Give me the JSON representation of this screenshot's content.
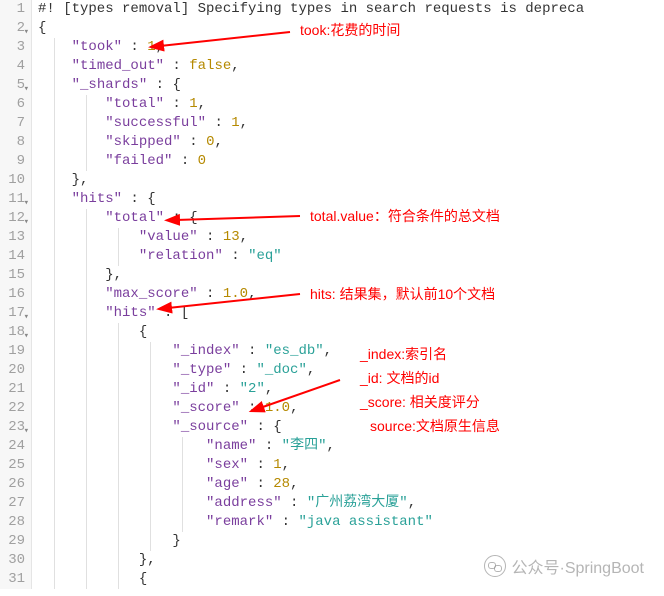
{
  "gutter_start": 1,
  "gutter_end": 31,
  "fold_lines": [
    2,
    5,
    11,
    12,
    17,
    18,
    23
  ],
  "lines": [
    {
      "indent": 0,
      "guides": [],
      "tokens": [
        {
          "cls": "punc",
          "t": "#! [types removal] Specifying types in search requests is depreca"
        }
      ]
    },
    {
      "indent": 0,
      "guides": [],
      "tokens": [
        {
          "cls": "punc",
          "t": "{"
        }
      ]
    },
    {
      "indent": 1,
      "guides": [
        1
      ],
      "tokens": [
        {
          "cls": "key",
          "t": "\"took\""
        },
        {
          "cls": "punc",
          "t": " : "
        },
        {
          "cls": "num",
          "t": "1"
        },
        {
          "cls": "punc",
          "t": ","
        }
      ]
    },
    {
      "indent": 1,
      "guides": [
        1
      ],
      "tokens": [
        {
          "cls": "key",
          "t": "\"timed_out\""
        },
        {
          "cls": "punc",
          "t": " : "
        },
        {
          "cls": "bool",
          "t": "false"
        },
        {
          "cls": "punc",
          "t": ","
        }
      ]
    },
    {
      "indent": 1,
      "guides": [
        1
      ],
      "tokens": [
        {
          "cls": "key",
          "t": "\"_shards\""
        },
        {
          "cls": "punc",
          "t": " : {"
        }
      ]
    },
    {
      "indent": 2,
      "guides": [
        1,
        2
      ],
      "tokens": [
        {
          "cls": "key",
          "t": "\"total\""
        },
        {
          "cls": "punc",
          "t": " : "
        },
        {
          "cls": "num",
          "t": "1"
        },
        {
          "cls": "punc",
          "t": ","
        }
      ]
    },
    {
      "indent": 2,
      "guides": [
        1,
        2
      ],
      "tokens": [
        {
          "cls": "key",
          "t": "\"successful\""
        },
        {
          "cls": "punc",
          "t": " : "
        },
        {
          "cls": "num",
          "t": "1"
        },
        {
          "cls": "punc",
          "t": ","
        }
      ]
    },
    {
      "indent": 2,
      "guides": [
        1,
        2
      ],
      "tokens": [
        {
          "cls": "key",
          "t": "\"skipped\""
        },
        {
          "cls": "punc",
          "t": " : "
        },
        {
          "cls": "num",
          "t": "0"
        },
        {
          "cls": "punc",
          "t": ","
        }
      ]
    },
    {
      "indent": 2,
      "guides": [
        1,
        2
      ],
      "tokens": [
        {
          "cls": "key",
          "t": "\"failed\""
        },
        {
          "cls": "punc",
          "t": " : "
        },
        {
          "cls": "num",
          "t": "0"
        }
      ]
    },
    {
      "indent": 1,
      "guides": [
        1
      ],
      "tokens": [
        {
          "cls": "punc",
          "t": "},"
        }
      ]
    },
    {
      "indent": 1,
      "guides": [
        1
      ],
      "tokens": [
        {
          "cls": "key",
          "t": "\"hits\""
        },
        {
          "cls": "punc",
          "t": " : {"
        }
      ]
    },
    {
      "indent": 2,
      "guides": [
        1,
        2
      ],
      "tokens": [
        {
          "cls": "key",
          "t": "\"total\""
        },
        {
          "cls": "punc",
          "t": " : {"
        }
      ]
    },
    {
      "indent": 3,
      "guides": [
        1,
        2,
        3
      ],
      "tokens": [
        {
          "cls": "key",
          "t": "\"value\""
        },
        {
          "cls": "punc",
          "t": " : "
        },
        {
          "cls": "num",
          "t": "13"
        },
        {
          "cls": "punc",
          "t": ","
        }
      ]
    },
    {
      "indent": 3,
      "guides": [
        1,
        2,
        3
      ],
      "tokens": [
        {
          "cls": "key",
          "t": "\"relation\""
        },
        {
          "cls": "punc",
          "t": " : "
        },
        {
          "cls": "str",
          "t": "\"eq\""
        }
      ]
    },
    {
      "indent": 2,
      "guides": [
        1,
        2
      ],
      "tokens": [
        {
          "cls": "punc",
          "t": "},"
        }
      ]
    },
    {
      "indent": 2,
      "guides": [
        1,
        2
      ],
      "tokens": [
        {
          "cls": "key",
          "t": "\"max_score\""
        },
        {
          "cls": "punc",
          "t": " : "
        },
        {
          "cls": "num",
          "t": "1.0"
        },
        {
          "cls": "punc",
          "t": ","
        }
      ]
    },
    {
      "indent": 2,
      "guides": [
        1,
        2
      ],
      "tokens": [
        {
          "cls": "key",
          "t": "\"hits\""
        },
        {
          "cls": "punc",
          "t": " : ["
        }
      ]
    },
    {
      "indent": 3,
      "guides": [
        1,
        2,
        3
      ],
      "tokens": [
        {
          "cls": "punc",
          "t": "{"
        }
      ]
    },
    {
      "indent": 4,
      "guides": [
        1,
        2,
        3,
        4
      ],
      "tokens": [
        {
          "cls": "key",
          "t": "\"_index\""
        },
        {
          "cls": "punc",
          "t": " : "
        },
        {
          "cls": "str",
          "t": "\"es_db\""
        },
        {
          "cls": "punc",
          "t": ","
        }
      ]
    },
    {
      "indent": 4,
      "guides": [
        1,
        2,
        3,
        4
      ],
      "tokens": [
        {
          "cls": "key",
          "t": "\"_type\""
        },
        {
          "cls": "punc",
          "t": " : "
        },
        {
          "cls": "str",
          "t": "\"_doc\""
        },
        {
          "cls": "punc",
          "t": ","
        }
      ]
    },
    {
      "indent": 4,
      "guides": [
        1,
        2,
        3,
        4
      ],
      "tokens": [
        {
          "cls": "key",
          "t": "\"_id\""
        },
        {
          "cls": "punc",
          "t": " : "
        },
        {
          "cls": "str",
          "t": "\"2\""
        },
        {
          "cls": "punc",
          "t": ","
        }
      ]
    },
    {
      "indent": 4,
      "guides": [
        1,
        2,
        3,
        4
      ],
      "tokens": [
        {
          "cls": "key",
          "t": "\"_score\""
        },
        {
          "cls": "punc",
          "t": " : "
        },
        {
          "cls": "num",
          "t": "1.0"
        },
        {
          "cls": "punc",
          "t": ","
        }
      ]
    },
    {
      "indent": 4,
      "guides": [
        1,
        2,
        3,
        4
      ],
      "tokens": [
        {
          "cls": "key",
          "t": "\"_source\""
        },
        {
          "cls": "punc",
          "t": " : {"
        }
      ]
    },
    {
      "indent": 5,
      "guides": [
        1,
        2,
        3,
        4,
        5
      ],
      "tokens": [
        {
          "cls": "key",
          "t": "\"name\""
        },
        {
          "cls": "punc",
          "t": " : "
        },
        {
          "cls": "str",
          "t": "\"李四\""
        },
        {
          "cls": "punc",
          "t": ","
        }
      ]
    },
    {
      "indent": 5,
      "guides": [
        1,
        2,
        3,
        4,
        5
      ],
      "tokens": [
        {
          "cls": "key",
          "t": "\"sex\""
        },
        {
          "cls": "punc",
          "t": " : "
        },
        {
          "cls": "num",
          "t": "1"
        },
        {
          "cls": "punc",
          "t": ","
        }
      ]
    },
    {
      "indent": 5,
      "guides": [
        1,
        2,
        3,
        4,
        5
      ],
      "tokens": [
        {
          "cls": "key",
          "t": "\"age\""
        },
        {
          "cls": "punc",
          "t": " : "
        },
        {
          "cls": "num",
          "t": "28"
        },
        {
          "cls": "punc",
          "t": ","
        }
      ]
    },
    {
      "indent": 5,
      "guides": [
        1,
        2,
        3,
        4,
        5
      ],
      "tokens": [
        {
          "cls": "key",
          "t": "\"address\""
        },
        {
          "cls": "punc",
          "t": " : "
        },
        {
          "cls": "str",
          "t": "\"广州荔湾大厦\""
        },
        {
          "cls": "punc",
          "t": ","
        }
      ]
    },
    {
      "indent": 5,
      "guides": [
        1,
        2,
        3,
        4,
        5
      ],
      "tokens": [
        {
          "cls": "key",
          "t": "\"remark\""
        },
        {
          "cls": "punc",
          "t": " : "
        },
        {
          "cls": "str",
          "t": "\"java assistant\""
        }
      ]
    },
    {
      "indent": 4,
      "guides": [
        1,
        2,
        3,
        4
      ],
      "tokens": [
        {
          "cls": "punc",
          "t": "}"
        }
      ]
    },
    {
      "indent": 3,
      "guides": [
        1,
        2,
        3
      ],
      "tokens": [
        {
          "cls": "punc",
          "t": "},"
        }
      ]
    },
    {
      "indent": 3,
      "guides": [
        1,
        2,
        3
      ],
      "tokens": [
        {
          "cls": "punc",
          "t": "{"
        }
      ]
    }
  ],
  "annotations": {
    "took": "took:花费的时间",
    "total": "total.value：符合条件的总文档",
    "hits": "hits: 结果集，默认前10个文档",
    "index": "_index:索引名",
    "id": "_id: 文档的id",
    "score": "_score: 相关度评分",
    "source": "source:文档原生信息"
  },
  "watermark": "公众号·SpringBoot"
}
